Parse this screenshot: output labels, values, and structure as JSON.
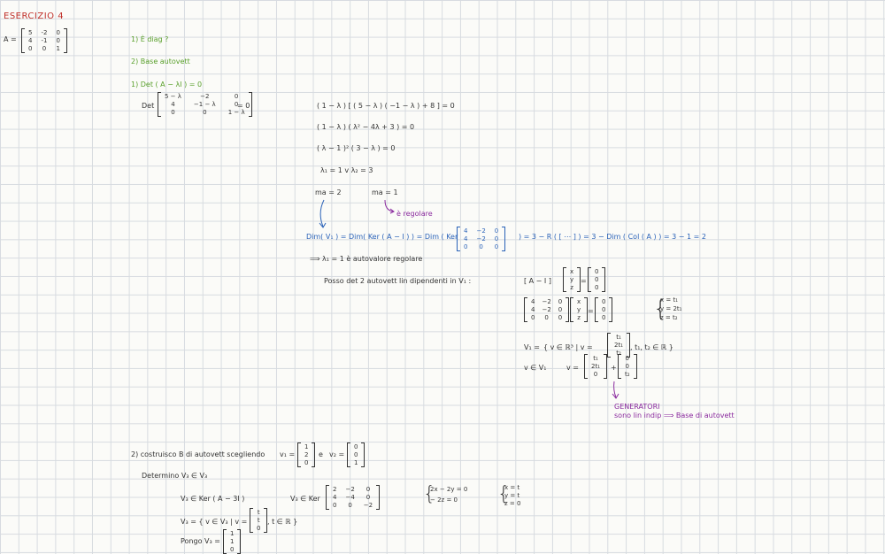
{
  "colors": {
    "title": "#c0302a",
    "question": "#5aa02c",
    "calc": "#2a62b8",
    "note": "#8a2a9e",
    "ink": "#333333"
  },
  "title": "ESERCIZIO 4",
  "matrix_A": {
    "label": "A =",
    "rows": [
      [
        "5",
        "-2",
        "0"
      ],
      [
        "4",
        "-1",
        "0"
      ],
      [
        "0",
        "0",
        "1"
      ]
    ]
  },
  "questions": {
    "q1": "1) È diag ?",
    "q2": "2) Base autovett"
  },
  "part1": {
    "header": "1)   Det ( A − λI ) = 0",
    "det_label": "Det",
    "det_rows": [
      [
        "5 − λ",
        "−2",
        "0"
      ],
      [
        "4",
        "−1 − λ",
        "0"
      ],
      [
        "0",
        "0",
        "1 − λ"
      ]
    ],
    "det_eq": "= 0",
    "line1": "( 1 − λ ) [ ( 5 − λ ) ( −1 − λ ) + 8 ] = 0",
    "line2": "( 1 − λ ) ( λ² − 4λ + 3 ) = 0",
    "line3": "( λ − 1 )² ( 3 − λ ) = 0",
    "line4": "λ₁ = 1     v     λ₂ = 3",
    "ma1": "ma = 2",
    "ma2": "ma = 1",
    "regolare_note": "è regolare",
    "dim_left": "Dim( V₁ ) = Dim( Ker ( A − I ) ) = Dim ( Ker",
    "dim_rows": [
      [
        "4",
        "−2",
        "0"
      ],
      [
        "4",
        "−2",
        "0"
      ],
      [
        "0",
        "0",
        "0"
      ]
    ],
    "dim_right": ") = 3 − R ( [ ⋯ ] ) = 3 − Dim ( Col ( A ) ) = 3 − 1 = 2",
    "conclusion": "⟹  λ₁ = 1    è autovalore regolare",
    "posso_text": "Posso det 2 autovett lin dipendenti in V₁ :",
    "AminusI_label": "[ A − I ]",
    "xyz": [
      "x",
      "y",
      "z"
    ],
    "zero_vec": [
      "0",
      "0",
      "0"
    ],
    "M_rows": [
      [
        "4",
        "−2",
        "0"
      ],
      [
        "4",
        "−2",
        "0"
      ],
      [
        "0",
        "0",
        "0"
      ]
    ],
    "system": [
      "x = t₁",
      "y = 2t₁",
      "z = t₂"
    ],
    "V1_label": "V₁ =",
    "V1_set_left": "{ v ∈ ℝ³  |  v =",
    "V1_vec": [
      "t₁",
      "2t₁",
      "t₂"
    ],
    "V1_set_right": ",   t₁, t₂ ∈ ℝ }",
    "vinV1": "v ∈ V₁",
    "v_eq": "v =",
    "vec_a": [
      "t₁",
      "2t₁",
      "0"
    ],
    "plus": "+",
    "vec_b": [
      "0",
      "0",
      "t₂"
    ],
    "gen_title": "GENERATORI",
    "gen_text": "sono lin indip  ⟹  Base di autovett"
  },
  "part2": {
    "header": "2)   costruisco  B  di autovett  scegliendo",
    "v1_label": "v₁ =",
    "v1_vec": [
      "1",
      "2",
      "0"
    ],
    "and_text": "e",
    "v2_label": "v₂ =",
    "v2_vec": [
      "0",
      "0",
      "1"
    ],
    "determino": "Determino  V₃ ∈ V₃",
    "v3_ker": "V₃ ∈ Ker ( A − 3I )",
    "v3_ker2": "V₃ ∈ Ker",
    "ker_rows": [
      [
        "2",
        "−2",
        "0"
      ],
      [
        "4",
        "−4",
        "0"
      ],
      [
        "0",
        "0",
        "−2"
      ]
    ],
    "sys2": [
      "2x − 2y = 0",
      "− 2z = 0"
    ],
    "sys3": [
      "x = t",
      "y = t",
      "z = 0"
    ],
    "v3_set_left": "V₃ = { v ∈ V₃  |  v =",
    "v3_vec": [
      "t",
      "t",
      "0"
    ],
    "v3_set_right": ",   t ∈ ℝ }",
    "pongo": "Pongo   V₃ =",
    "pongo_vec": [
      "1",
      "1",
      "0"
    ]
  }
}
